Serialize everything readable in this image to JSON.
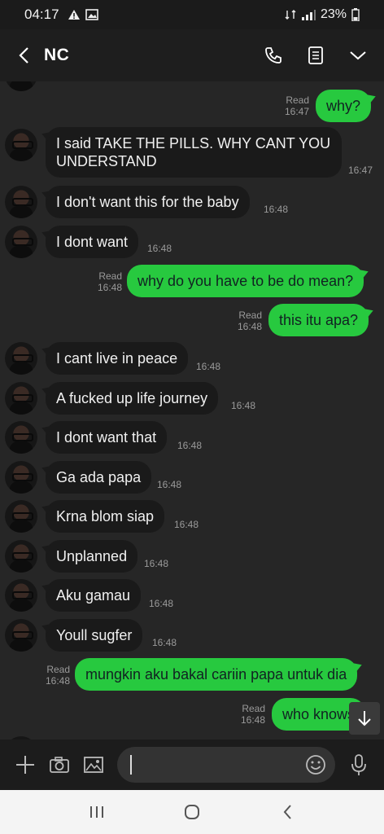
{
  "status_bar": {
    "time": "04:17",
    "battery": "23%"
  },
  "header": {
    "title": "NC"
  },
  "messages": [
    {
      "side": "out",
      "text": "why?",
      "read": "Read",
      "time": "16:47"
    },
    {
      "side": "in",
      "text": "I said TAKE THE PILLS. WHY CANT YOU UNDERSTAND",
      "time": "16:47"
    },
    {
      "side": "in",
      "text": "I don't want this for the baby",
      "time": "16:48"
    },
    {
      "side": "in",
      "text": "I dont want",
      "time": "16:48"
    },
    {
      "side": "out",
      "text": "why do you have to be do mean?",
      "read": "Read",
      "time": "16:48"
    },
    {
      "side": "out",
      "text": "this itu apa?",
      "read": "Read",
      "time": "16:48"
    },
    {
      "side": "in",
      "text": "I cant live in peace",
      "time": "16:48"
    },
    {
      "side": "in",
      "text": "A fucked up life journey",
      "time": "16:48"
    },
    {
      "side": "in",
      "text": "I dont want that",
      "time": "16:48"
    },
    {
      "side": "in",
      "text": "Ga ada papa",
      "time": "16:48"
    },
    {
      "side": "in",
      "text": "Krna blom siap",
      "time": "16:48"
    },
    {
      "side": "in",
      "text": "Unplanned",
      "time": "16:48"
    },
    {
      "side": "in",
      "text": "Aku gamau",
      "time": "16:48"
    },
    {
      "side": "in",
      "text": "Youll sugfer",
      "time": "16:48"
    },
    {
      "side": "out",
      "text": "mungkin aku bakal cariin papa untuk dia",
      "read": "Read",
      "time": "16:48"
    },
    {
      "side": "out",
      "text": "who knows",
      "read": "Read",
      "time": "16:48"
    }
  ]
}
